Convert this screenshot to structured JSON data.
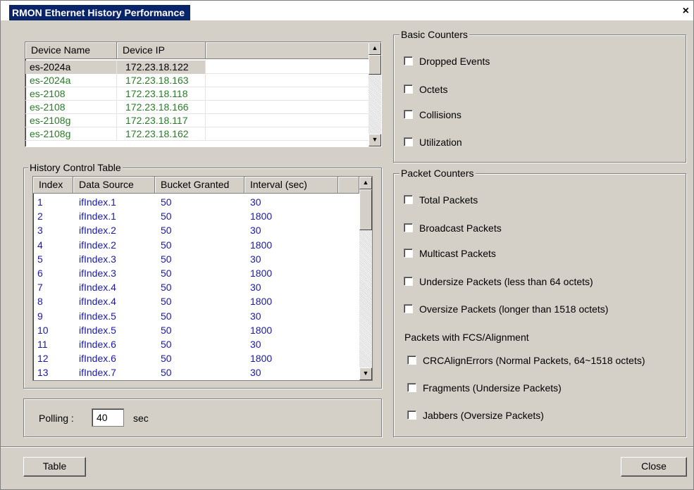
{
  "window": {
    "title": "RMON Ethernet History Performance",
    "close_glyph": "×"
  },
  "device_table": {
    "columns": [
      "Device Name",
      "Device IP"
    ],
    "rows": [
      {
        "name": "es-2024a",
        "ip": "172.23.18.122",
        "selected": true
      },
      {
        "name": "es-2024a",
        "ip": "172.23.18.163"
      },
      {
        "name": "es-2108",
        "ip": "172.23.18.118"
      },
      {
        "name": "es-2108",
        "ip": "172.23.18.166"
      },
      {
        "name": "es-2108g",
        "ip": "172.23.18.117"
      },
      {
        "name": "es-2108g",
        "ip": "172.23.18.162"
      }
    ],
    "row_color": "#2a7a2a"
  },
  "history_control": {
    "label": "History Control Table",
    "columns": [
      "Index",
      "Data Source",
      "Bucket Granted",
      "Interval (sec)"
    ],
    "rows": [
      [
        "1",
        "ifIndex.1",
        "50",
        "30"
      ],
      [
        "2",
        "ifIndex.1",
        "50",
        "1800"
      ],
      [
        "3",
        "ifIndex.2",
        "50",
        "30"
      ],
      [
        "4",
        "ifIndex.2",
        "50",
        "1800"
      ],
      [
        "5",
        "ifIndex.3",
        "50",
        "30"
      ],
      [
        "6",
        "ifIndex.3",
        "50",
        "1800"
      ],
      [
        "7",
        "ifIndex.4",
        "50",
        "30"
      ],
      [
        "8",
        "ifIndex.4",
        "50",
        "1800"
      ],
      [
        "9",
        "ifIndex.5",
        "50",
        "30"
      ],
      [
        "10",
        "ifIndex.5",
        "50",
        "1800"
      ],
      [
        "11",
        "ifIndex.6",
        "50",
        "30"
      ],
      [
        "12",
        "ifIndex.6",
        "50",
        "1800"
      ],
      [
        "13",
        "ifIndex.7",
        "50",
        "30"
      ]
    ]
  },
  "polling": {
    "label": "Polling :",
    "value": "40",
    "unit": "sec"
  },
  "basic_counters": {
    "label": "Basic Counters",
    "items": [
      "Dropped Events",
      "Octets",
      "Collisions",
      "Utilization"
    ]
  },
  "packet_counters": {
    "label": "Packet Counters",
    "items": [
      "Total Packets",
      "Broadcast Packets",
      "Multicast Packets",
      "Undersize Packets (less than 64 octets)",
      "Oversize Packets (longer than 1518 octets)"
    ],
    "fcs_label": "Packets with FCS/Alignment",
    "fcs_items": [
      "CRCAlignErrors (Normal Packets, 64~1518 octets)",
      "Fragments (Undersize Packets)",
      "Jabbers (Oversize Packets)"
    ]
  },
  "buttons": {
    "table": "Table",
    "close": "Close"
  },
  "colors": {
    "title_bg": "#0a246a",
    "panel_bg": "#d4d0c8",
    "history_text": "#1a1aa0",
    "device_text": "#2a7a2a"
  }
}
